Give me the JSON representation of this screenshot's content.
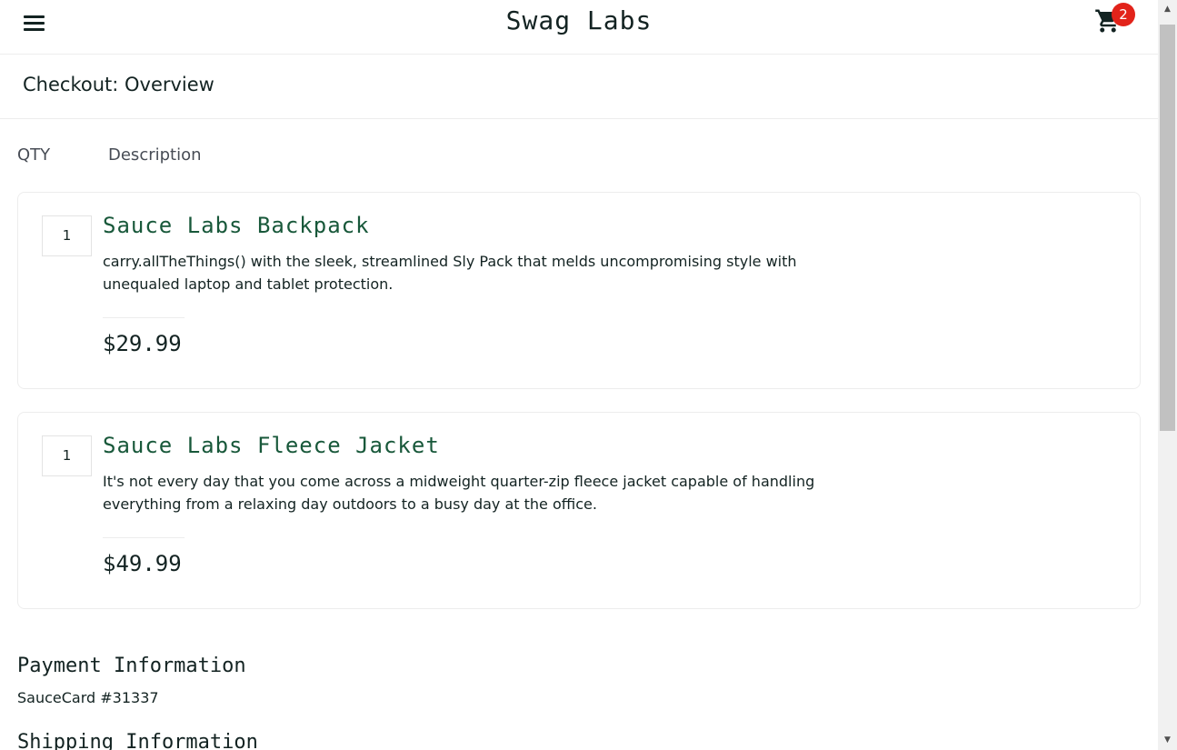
{
  "header": {
    "app_title": "Swag Labs",
    "menu_icon": "hamburger-menu-icon",
    "cart_icon": "shopping-cart-icon",
    "cart_count": "2",
    "badge_color": "#e2231a"
  },
  "page": {
    "title": "Checkout: Overview"
  },
  "columns": {
    "qty": "QTY",
    "description": "Description"
  },
  "items": [
    {
      "qty": "1",
      "name": "Sauce Labs Backpack",
      "description": "carry.allTheThings() with the sleek, streamlined Sly Pack that melds uncompromising style with unequaled laptop and tablet protection.",
      "price": "$29.99"
    },
    {
      "qty": "1",
      "name": "Sauce Labs Fleece Jacket",
      "description": "It's not every day that you come across a midweight quarter-zip fleece jacket capable of handling everything from a relaxing day outdoors to a busy day at the office.",
      "price": "$49.99"
    }
  ],
  "summary": {
    "payment_label": "Payment Information",
    "payment_value": "SauceCard #31337",
    "shipping_label": "Shipping Information"
  },
  "colors": {
    "item_name": "#18583a",
    "text": "#132322",
    "border": "#ededed"
  }
}
